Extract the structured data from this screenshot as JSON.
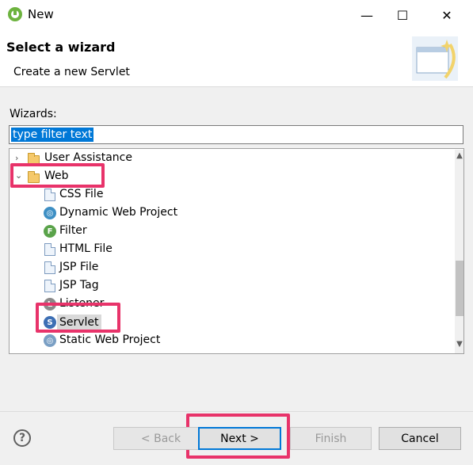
{
  "window": {
    "title": "New"
  },
  "header": {
    "title": "Select a wizard",
    "description": "Create a new Servlet"
  },
  "filter": {
    "label": "Wizards:",
    "value": "type filter text"
  },
  "tree": {
    "items": [
      {
        "label": "User Assistance",
        "type": "folder",
        "expanded": false
      },
      {
        "label": "Web",
        "type": "folder",
        "expanded": true
      },
      {
        "label": "CSS File",
        "type": "file"
      },
      {
        "label": "Dynamic Web Project",
        "type": "file"
      },
      {
        "label": "Filter",
        "type": "file"
      },
      {
        "label": "HTML File",
        "type": "file"
      },
      {
        "label": "JSP File",
        "type": "file"
      },
      {
        "label": "JSP Tag",
        "type": "file"
      },
      {
        "label": "Listener",
        "type": "file"
      },
      {
        "label": "Servlet",
        "type": "file",
        "selected": true
      },
      {
        "label": "Static Web Project",
        "type": "file"
      }
    ]
  },
  "buttons": {
    "back": "< Back",
    "next": "Next >",
    "finish": "Finish",
    "cancel": "Cancel"
  },
  "icons": {
    "help": "?",
    "minimize": "—",
    "maximize": "☐",
    "close": "✕"
  },
  "colors": {
    "highlight": "#e8336a",
    "accent": "#0078d7"
  }
}
